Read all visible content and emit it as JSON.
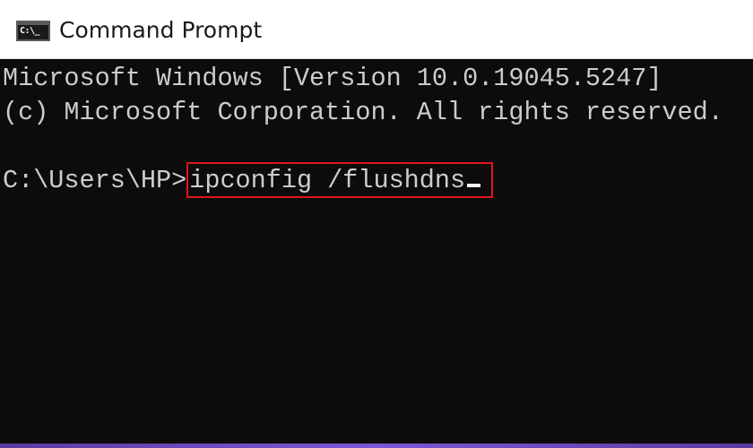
{
  "window": {
    "title": "Command Prompt",
    "icon_name": "command-prompt-icon",
    "icon_text": "C:\\_"
  },
  "console": {
    "lines": [
      "Microsoft Windows [Version 10.0.19045.5247]",
      "(c) Microsoft Corporation. All rights reserved.",
      ""
    ],
    "prompt": "C:\\Users\\HP>",
    "command": "ipconfig /flushdns"
  },
  "colors": {
    "console_background": "#0c0c0c",
    "console_text": "#cccccc",
    "highlight_border": "#e0141e",
    "titlebar_background": "#ffffff"
  }
}
